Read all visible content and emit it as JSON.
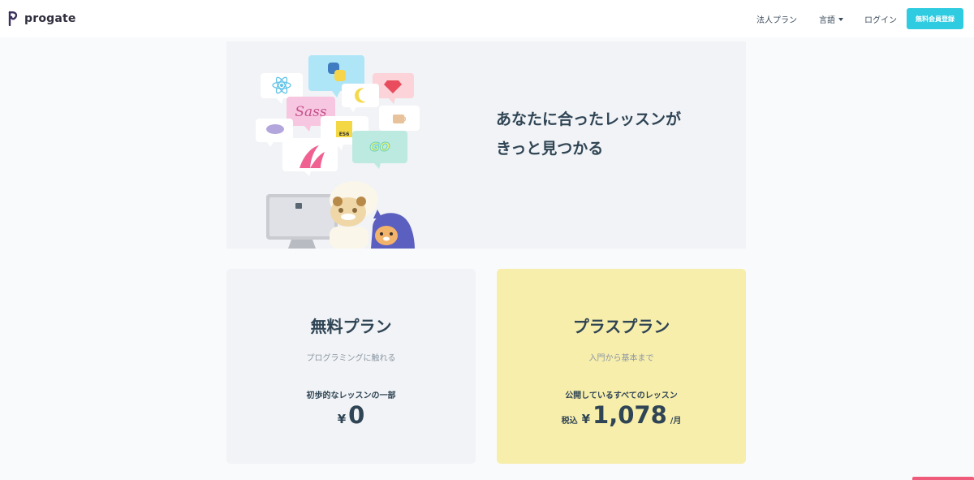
{
  "header": {
    "logo_text": "progate",
    "nav": {
      "corporate": "法人プラン",
      "language": "言語",
      "login": "ログイン",
      "signup": "無料会員登録"
    }
  },
  "hero": {
    "title_line1": "あなたに合ったレッスンが",
    "title_line2": "きっと見つかる",
    "illustration_badges": [
      "GO",
      "ES6"
    ]
  },
  "plans": {
    "free": {
      "title": "無料プラン",
      "subtitle": "プログラミングに触れる",
      "description": "初歩的なレッスンの一部",
      "currency": "¥",
      "price": "0"
    },
    "plus": {
      "title": "プラスプラン",
      "subtitle": "入門から基本まで",
      "description": "公開しているすべてのレッスン",
      "tax_label": "税込",
      "currency": "¥",
      "price": "1,078",
      "unit": "/月"
    }
  },
  "colors": {
    "accent": "#2fcbe0",
    "free_card": "#f1f3f6",
    "plus_card": "#f8eeab",
    "text_dark": "#2f4454"
  }
}
